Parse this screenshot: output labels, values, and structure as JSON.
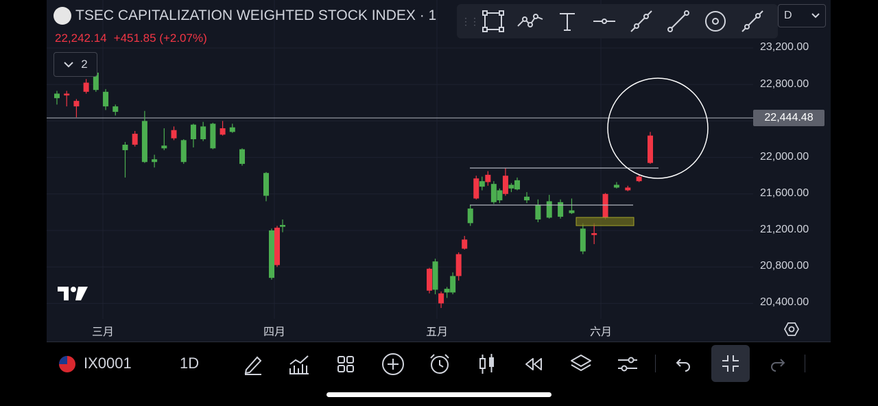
{
  "header": {
    "title": "TSEC CAPITALIZATION WEIGHTED STOCK INDEX · 1",
    "last_price": "22,242.14",
    "change": "+451.85 (+2.07%)",
    "collapse_count": "2",
    "interval_select": "D"
  },
  "price_axis": {
    "labels": [
      "23,200.00",
      "22,800.00",
      "22,000.00",
      "21,600.00",
      "21,200.00",
      "20,800.00",
      "20,400.00"
    ],
    "current_price": "22,444.48"
  },
  "time_axis": {
    "labels": [
      "三月",
      "四月",
      "五月",
      "六月"
    ]
  },
  "colors": {
    "up": "#4caf50",
    "down": "#f23645",
    "background": "#131722",
    "highlight_zone": "#6b6b1f"
  },
  "drawing_tools": [
    "rectangle-icon",
    "path-icon",
    "text-icon",
    "horizontal-line-icon",
    "trend-angle-icon",
    "trend-line-icon",
    "circle-target-icon",
    "extended-line-icon"
  ],
  "bottom_bar": {
    "symbol": "IX0001",
    "interval": "1D",
    "buttons": [
      "pencil-icon",
      "indicators-icon",
      "layout-grid-icon",
      "add-icon",
      "alarm-icon",
      "candles-icon",
      "replay-icon",
      "layers-icon",
      "settings-sliders-icon",
      "undo-icon",
      "fullscreen-exit-icon",
      "redo-icon"
    ]
  },
  "candles": [
    {
      "o": 22650,
      "c": 22700,
      "h": 22730,
      "l": 22580,
      "d": "up"
    },
    {
      "o": 22700,
      "c": 22680,
      "h": 22730,
      "l": 22560,
      "d": "down"
    },
    {
      "o": 22620,
      "c": 22560,
      "h": 22640,
      "l": 22440,
      "d": "down"
    },
    {
      "o": 22820,
      "c": 22720,
      "h": 22860,
      "l": 22700,
      "d": "down"
    },
    {
      "o": 22740,
      "c": 22930,
      "h": 22990,
      "l": 22720,
      "d": "up"
    },
    {
      "o": 22720,
      "c": 22560,
      "h": 22750,
      "l": 22520,
      "d": "up"
    },
    {
      "o": 22560,
      "c": 22500,
      "h": 22580,
      "l": 22460,
      "d": "up"
    },
    {
      "o": 22140,
      "c": 22080,
      "h": 22170,
      "l": 21780,
      "d": "up"
    },
    {
      "o": 22140,
      "c": 22260,
      "h": 22290,
      "l": 22120,
      "d": "down"
    },
    {
      "o": 22400,
      "c": 21950,
      "h": 22510,
      "l": 21940,
      "d": "up"
    },
    {
      "o": 21980,
      "c": 21950,
      "h": 22030,
      "l": 21890,
      "d": "up"
    },
    {
      "o": 22130,
      "c": 22100,
      "h": 22320,
      "l": 22080,
      "d": "up"
    },
    {
      "o": 22300,
      "c": 22210,
      "h": 22340,
      "l": 22190,
      "d": "down"
    },
    {
      "o": 22190,
      "c": 21950,
      "h": 22200,
      "l": 21930,
      "d": "up"
    },
    {
      "o": 22200,
      "c": 22360,
      "h": 22370,
      "l": 22110,
      "d": "up"
    },
    {
      "o": 22340,
      "c": 22200,
      "h": 22390,
      "l": 22180,
      "d": "up"
    },
    {
      "o": 22370,
      "c": 22100,
      "h": 22380,
      "l": 22090,
      "d": "up"
    },
    {
      "o": 22250,
      "c": 22320,
      "h": 22400,
      "l": 22240,
      "d": "down"
    },
    {
      "o": 22280,
      "c": 22330,
      "h": 22370,
      "l": 22270,
      "d": "up"
    },
    {
      "o": 22090,
      "c": 21930,
      "h": 22100,
      "l": 21910,
      "d": "up"
    },
    {
      "o": 21830,
      "c": 21580,
      "h": 21840,
      "l": 21520,
      "d": "up"
    },
    {
      "o": 21200,
      "c": 20680,
      "h": 21220,
      "l": 20660,
      "d": "up"
    },
    {
      "o": 21230,
      "c": 20820,
      "h": 21250,
      "l": 20800,
      "d": "down"
    },
    {
      "o": 21260,
      "c": 21240,
      "h": 21320,
      "l": 21180,
      "d": "up"
    },
    {
      "o": 20780,
      "c": 20540,
      "h": 20790,
      "l": 20510,
      "d": "down"
    },
    {
      "o": 20860,
      "c": 20550,
      "h": 20890,
      "l": 20500,
      "d": "up"
    },
    {
      "o": 20400,
      "c": 20510,
      "h": 20530,
      "l": 20350,
      "d": "down"
    },
    {
      "o": 20560,
      "c": 20520,
      "h": 20580,
      "l": 20460,
      "d": "up"
    },
    {
      "o": 20700,
      "c": 20520,
      "h": 20740,
      "l": 20500,
      "d": "up"
    },
    {
      "o": 20700,
      "c": 20940,
      "h": 20960,
      "l": 20650,
      "d": "down"
    },
    {
      "o": 21100,
      "c": 21000,
      "h": 21140,
      "l": 20990,
      "d": "down"
    },
    {
      "o": 21440,
      "c": 21280,
      "h": 21480,
      "l": 21250,
      "d": "up"
    },
    {
      "o": 21770,
      "c": 21550,
      "h": 21800,
      "l": 21540,
      "d": "down"
    },
    {
      "o": 21740,
      "c": 21680,
      "h": 21790,
      "l": 21640,
      "d": "up"
    },
    {
      "o": 21810,
      "c": 21730,
      "h": 21850,
      "l": 21690,
      "d": "down"
    },
    {
      "o": 21710,
      "c": 21510,
      "h": 21740,
      "l": 21490,
      "d": "up"
    },
    {
      "o": 21640,
      "c": 21530,
      "h": 21660,
      "l": 21500,
      "d": "up"
    },
    {
      "o": 21800,
      "c": 21600,
      "h": 21880,
      "l": 21580,
      "d": "down"
    },
    {
      "o": 21700,
      "c": 21660,
      "h": 21720,
      "l": 21620,
      "d": "up"
    },
    {
      "o": 21750,
      "c": 21650,
      "h": 21780,
      "l": 21640,
      "d": "up"
    },
    {
      "o": 21570,
      "c": 21530,
      "h": 21620,
      "l": 21500,
      "d": "up"
    },
    {
      "o": 21480,
      "c": 21320,
      "h": 21540,
      "l": 21290,
      "d": "up"
    },
    {
      "o": 21520,
      "c": 21340,
      "h": 21590,
      "l": 21330,
      "d": "up"
    },
    {
      "o": 21510,
      "c": 21350,
      "h": 21540,
      "l": 21330,
      "d": "up"
    },
    {
      "o": 21420,
      "c": 21390,
      "h": 21550,
      "l": 21380,
      "d": "up"
    },
    {
      "o": 21220,
      "c": 20970,
      "h": 21280,
      "l": 20940,
      "d": "up"
    },
    {
      "o": 21170,
      "c": 21150,
      "h": 21280,
      "l": 21050,
      "d": "down"
    },
    {
      "o": 21340,
      "c": 21600,
      "h": 21610,
      "l": 21320,
      "d": "down"
    },
    {
      "o": 21670,
      "c": 21700,
      "h": 21730,
      "l": 21660,
      "d": "up"
    },
    {
      "o": 21640,
      "c": 21670,
      "h": 21690,
      "l": 21630,
      "d": "down"
    },
    {
      "o": 21740,
      "c": 21790,
      "h": 21810,
      "l": 21730,
      "d": "down"
    },
    {
      "o": 21940,
      "c": 22240,
      "h": 22280,
      "l": 21930,
      "d": "down"
    }
  ]
}
